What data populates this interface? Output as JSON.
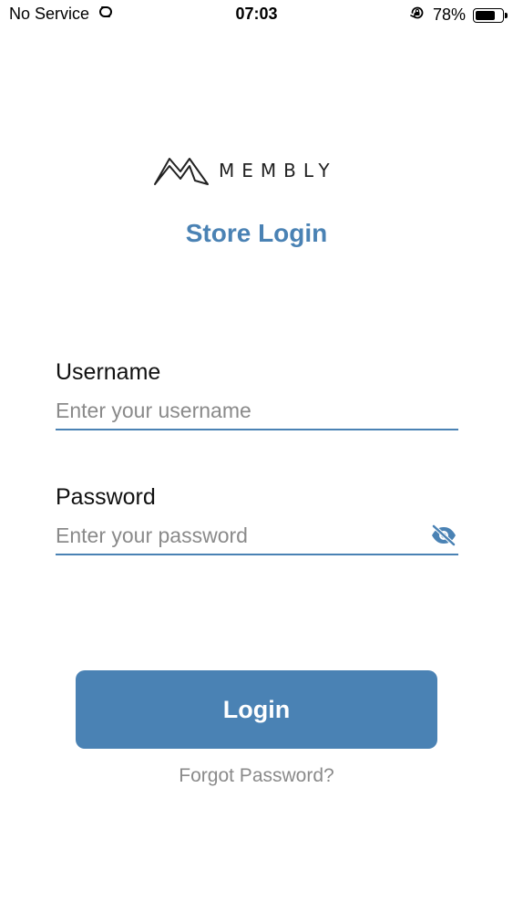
{
  "status_bar": {
    "carrier": "No Service",
    "time": "07:03",
    "battery_percent": "78%",
    "battery_level": 0.78,
    "icons": [
      "link-icon",
      "orientation-lock-icon",
      "battery-icon"
    ]
  },
  "brand": {
    "name": "MEMBLY",
    "logo_icon": "membly-mountain-icon"
  },
  "screen": {
    "title": "Store Login"
  },
  "form": {
    "username": {
      "label": "Username",
      "value": "",
      "placeholder": "Enter your username"
    },
    "password": {
      "label": "Password",
      "value": "",
      "placeholder": "Enter your password",
      "toggle_icon": "eye-off-icon"
    },
    "login_label": "Login",
    "forgot_label": "Forgot Password?"
  },
  "colors": {
    "accent": "#4a82b4",
    "placeholder": "#8a8a8a",
    "text": "#111111",
    "background": "#ffffff"
  }
}
